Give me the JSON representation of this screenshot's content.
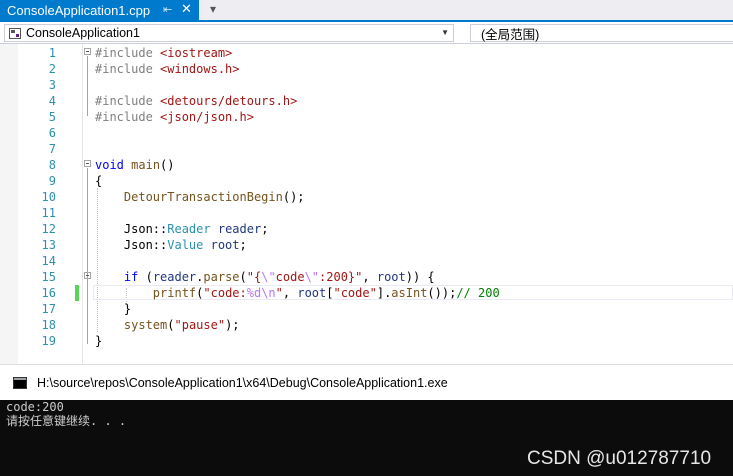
{
  "tab": {
    "title": "ConsoleApplication1.cpp",
    "pin_icon": "pin-icon",
    "close_icon": "close-icon",
    "more_icon": "dropdown-icon"
  },
  "navbar": {
    "project": "ConsoleApplication1",
    "scope": "(全局范围)"
  },
  "editor": {
    "line_numbers": [
      "1",
      "2",
      "3",
      "4",
      "5",
      "6",
      "7",
      "8",
      "9",
      "10",
      "11",
      "12",
      "13",
      "14",
      "15",
      "16",
      "17",
      "18",
      "19"
    ],
    "lines": [
      [
        {
          "t": "#include ",
          "c": "pp"
        },
        {
          "t": "<iostream>",
          "c": "str"
        }
      ],
      [
        {
          "t": "#include ",
          "c": "pp"
        },
        {
          "t": "<windows.h>",
          "c": "str"
        }
      ],
      [],
      [
        {
          "t": "#include ",
          "c": "pp"
        },
        {
          "t": "<detours/detours.h>",
          "c": "str"
        }
      ],
      [
        {
          "t": "#include ",
          "c": "pp"
        },
        {
          "t": "<json/json.h>",
          "c": "str"
        }
      ],
      [],
      [],
      [
        {
          "t": "void",
          "c": "kw"
        },
        {
          "t": " ",
          "c": ""
        },
        {
          "t": "main",
          "c": "fn"
        },
        {
          "t": "()",
          "c": ""
        }
      ],
      [
        {
          "t": "{",
          "c": ""
        }
      ],
      [
        {
          "t": "    ",
          "c": ""
        },
        {
          "t": "DetourTransactionBegin",
          "c": "fn"
        },
        {
          "t": "();",
          "c": ""
        }
      ],
      [],
      [
        {
          "t": "    Json::",
          "c": ""
        },
        {
          "t": "Reader",
          "c": "type"
        },
        {
          "t": " ",
          "c": ""
        },
        {
          "t": "reader",
          "c": "var"
        },
        {
          "t": ";",
          "c": ""
        }
      ],
      [
        {
          "t": "    Json::",
          "c": ""
        },
        {
          "t": "Value",
          "c": "type"
        },
        {
          "t": " ",
          "c": ""
        },
        {
          "t": "root",
          "c": "var"
        },
        {
          "t": ";",
          "c": ""
        }
      ],
      [],
      [
        {
          "t": "    ",
          "c": ""
        },
        {
          "t": "if",
          "c": "kw"
        },
        {
          "t": " (",
          "c": ""
        },
        {
          "t": "reader",
          "c": "var"
        },
        {
          "t": ".",
          "c": ""
        },
        {
          "t": "parse",
          "c": "fn"
        },
        {
          "t": "(",
          "c": ""
        },
        {
          "t": "\"{",
          "c": "str"
        },
        {
          "t": "\\\"",
          "c": "esc"
        },
        {
          "t": "code",
          "c": "str"
        },
        {
          "t": "\\\"",
          "c": "esc"
        },
        {
          "t": ":200}\"",
          "c": "str"
        },
        {
          "t": ", ",
          "c": ""
        },
        {
          "t": "root",
          "c": "var"
        },
        {
          "t": ")) {",
          "c": ""
        }
      ],
      [
        {
          "t": "        ",
          "c": ""
        },
        {
          "t": "printf",
          "c": "fn"
        },
        {
          "t": "(",
          "c": ""
        },
        {
          "t": "\"code:",
          "c": "str"
        },
        {
          "t": "%d",
          "c": "esc"
        },
        {
          "t": "\\n",
          "c": "esc"
        },
        {
          "t": "\"",
          "c": "str"
        },
        {
          "t": ", ",
          "c": ""
        },
        {
          "t": "root",
          "c": "var"
        },
        {
          "t": "[",
          "c": ""
        },
        {
          "t": "\"code\"",
          "c": "str"
        },
        {
          "t": "].",
          "c": ""
        },
        {
          "t": "asInt",
          "c": "fn"
        },
        {
          "t": "());",
          "c": ""
        },
        {
          "t": "// 200",
          "c": "cmt"
        }
      ],
      [
        {
          "t": "    }",
          "c": ""
        }
      ],
      [
        {
          "t": "    ",
          "c": ""
        },
        {
          "t": "system",
          "c": "fn"
        },
        {
          "t": "(",
          "c": ""
        },
        {
          "t": "\"pause\"",
          "c": "str"
        },
        {
          "t": ");",
          "c": ""
        }
      ],
      [
        {
          "t": "}",
          "c": ""
        }
      ]
    ],
    "fold_lines": [
      1,
      8,
      15
    ],
    "changed_line": 16,
    "current_line": 16
  },
  "console": {
    "title": "H:\\source\\repos\\ConsoleApplication1\\x64\\Debug\\ConsoleApplication1.exe",
    "output": [
      "code:200",
      "请按任意键继续. . ."
    ]
  },
  "watermark": "CSDN @u012787710",
  "colors": {
    "accent": "#007acc",
    "keyword": "#0000ff",
    "string": "#a31515",
    "escape": "#b776fb",
    "function": "#74531f",
    "type": "#2b91af",
    "variable": "#1f377f",
    "comment": "#008000",
    "preprocessor": "#808080",
    "line_number": "#2b91af",
    "change_marker": "#57d557"
  }
}
